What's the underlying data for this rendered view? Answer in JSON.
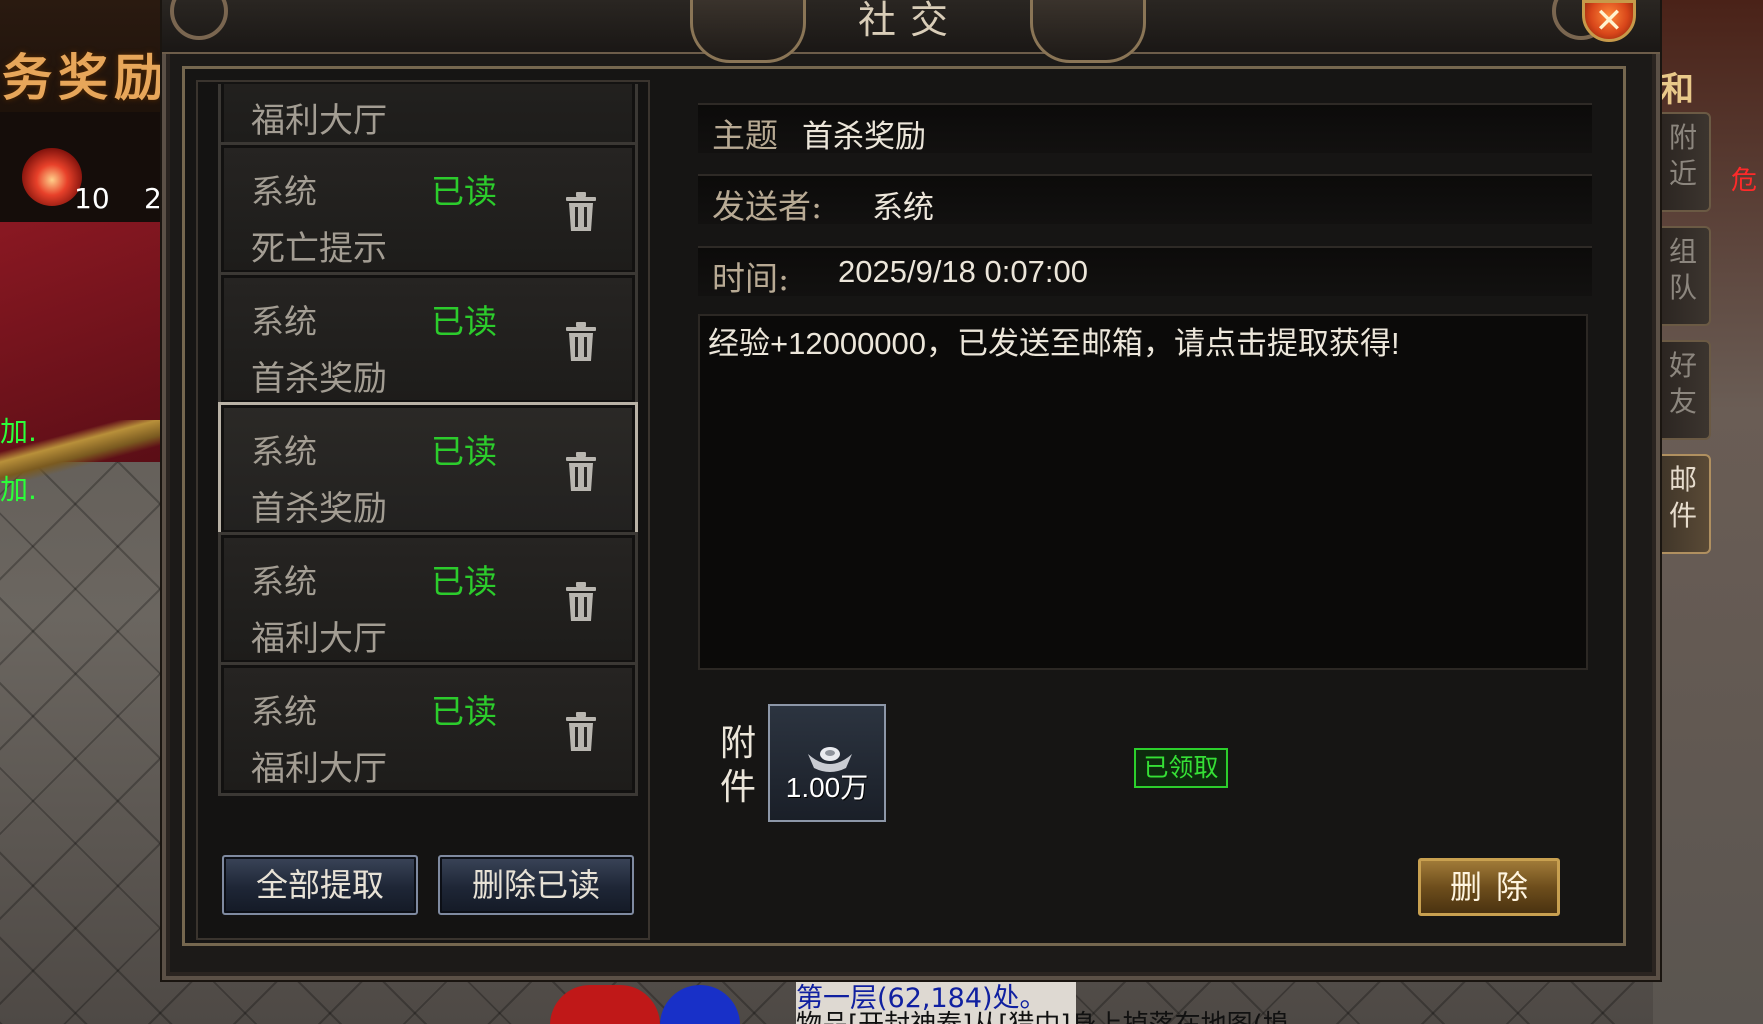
{
  "background": {
    "left_title": "务奖励",
    "left_counts": [
      "10",
      "2"
    ],
    "left_chat": [
      "加.",
      "加."
    ],
    "right_red_text": "危",
    "bottom_chat_line1": "第一层(62,184)处。",
    "bottom_chat_line2": "物品[开封神泰]从[猎中]身上掉落在地图(埠"
  },
  "window": {
    "title": "社交",
    "close_icon": "close-icon"
  },
  "side_tabs": {
    "top_char": "和",
    "items": [
      {
        "label": "附\n近",
        "active": false
      },
      {
        "label": "组\n队",
        "active": false
      },
      {
        "label": "好\n友",
        "active": false
      },
      {
        "label": "邮\n件",
        "active": true
      }
    ]
  },
  "mail_list": {
    "top_partial_subject": "福利大厅",
    "items": [
      {
        "sender": "系统",
        "status": "已读",
        "subject": "死亡提示",
        "selected": false
      },
      {
        "sender": "系统",
        "status": "已读",
        "subject": "首杀奖励",
        "selected": false
      },
      {
        "sender": "系统",
        "status": "已读",
        "subject": "首杀奖励",
        "selected": true
      },
      {
        "sender": "系统",
        "status": "已读",
        "subject": "福利大厅",
        "selected": false
      },
      {
        "sender": "系统",
        "status": "已读",
        "subject": "福利大厅",
        "selected": false
      }
    ],
    "claim_all_label": "全部提取",
    "delete_read_label": "删除已读"
  },
  "detail": {
    "subject_label": "主题",
    "subject_value": "首杀奖励",
    "sender_label": "发送者:",
    "sender_value": "系统",
    "time_label": "时间:",
    "time_value": "2025/9/18 0:07:00",
    "body": "经验+12000000，已发送至邮箱，请点击提取获得!",
    "attachment_label": "附\n件",
    "attachment_qty": "1.00万",
    "claimed_label": "已领取",
    "delete_label": "删除"
  },
  "colors": {
    "read_status": "#2ccc2c",
    "claimed": "#35e035",
    "frame_gold": "#75674f"
  }
}
